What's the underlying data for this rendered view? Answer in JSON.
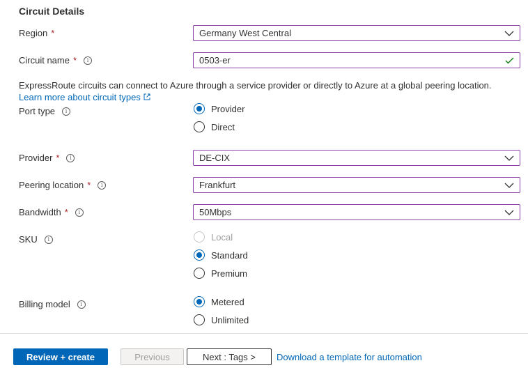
{
  "section": {
    "title": "Circuit Details"
  },
  "region": {
    "label": "Region",
    "required": "*",
    "value": "Germany West Central"
  },
  "circuit_name": {
    "label": "Circuit name",
    "required": "*",
    "value": "0503-er"
  },
  "description": {
    "text": "ExpressRoute circuits can connect to Azure through a service provider or directly to Azure at a global peering location.",
    "link": "Learn more about circuit types"
  },
  "port_type": {
    "label": "Port type",
    "options": [
      {
        "label": "Provider",
        "checked": true
      },
      {
        "label": "Direct",
        "checked": false
      }
    ]
  },
  "provider": {
    "label": "Provider",
    "required": "*",
    "value": "DE-CIX"
  },
  "peering_location": {
    "label": "Peering location",
    "required": "*",
    "value": "Frankfurt"
  },
  "bandwidth": {
    "label": "Bandwidth",
    "required": "*",
    "value": "50Mbps"
  },
  "sku": {
    "label": "SKU",
    "options": [
      {
        "label": "Local",
        "checked": false,
        "disabled": true
      },
      {
        "label": "Standard",
        "checked": true
      },
      {
        "label": "Premium",
        "checked": false
      }
    ]
  },
  "billing_model": {
    "label": "Billing model",
    "options": [
      {
        "label": "Metered",
        "checked": true
      },
      {
        "label": "Unlimited",
        "checked": false
      }
    ]
  },
  "footer": {
    "review_create": "Review + create",
    "previous": "Previous",
    "next": "Next : Tags >",
    "download_template": "Download a template for automation"
  },
  "colors": {
    "accent": "#0067b8",
    "field_border": "#8a3fa8",
    "required": "#a4262c",
    "valid_check": "#107c10"
  },
  "icons": {
    "info": "info-icon",
    "chevron": "chevron-down-icon",
    "check": "checkmark-icon",
    "external": "external-link-icon"
  }
}
